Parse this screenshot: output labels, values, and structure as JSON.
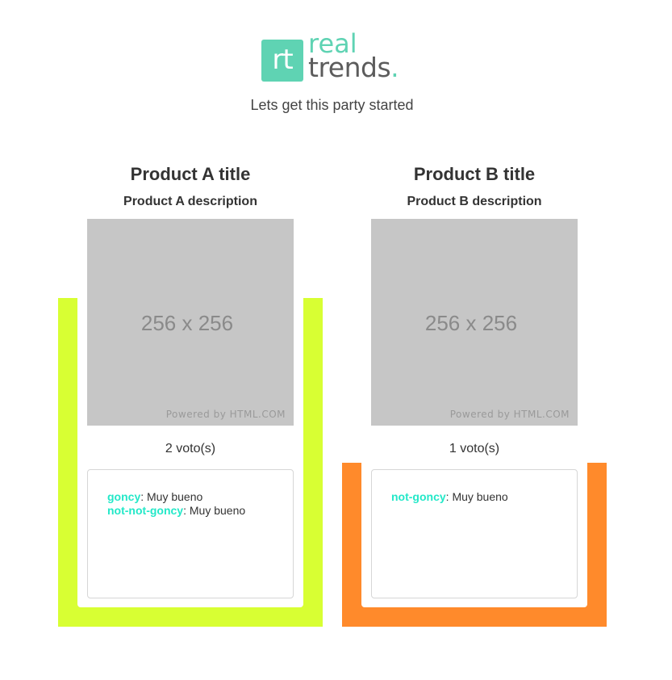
{
  "logo": {
    "badge": "rt",
    "word_top": "real",
    "word_bottom": "trends",
    "dot": "."
  },
  "tagline": "Lets get this party started",
  "colors": {
    "brand": "#5fd3b3",
    "frame_a": "#d8ff33",
    "frame_b": "#ff8a2b",
    "comment_user": "#23e8c8"
  },
  "products": [
    {
      "title": "Product A title",
      "description": "Product A description",
      "image_size": "256 x 256",
      "image_credit": "Powered by HTML.COM",
      "votes": "2 voto(s)",
      "comments": [
        {
          "user": "goncy",
          "separator": ": ",
          "text": "Muy bueno"
        },
        {
          "user": "not-not-goncy",
          "separator": ": ",
          "text": "Muy bueno"
        }
      ]
    },
    {
      "title": "Product B title",
      "description": "Product B description",
      "image_size": "256 x 256",
      "image_credit": "Powered by HTML.COM",
      "votes": "1 voto(s)",
      "comments": [
        {
          "user": "not-goncy",
          "separator": ": ",
          "text": "Muy bueno"
        }
      ]
    }
  ]
}
